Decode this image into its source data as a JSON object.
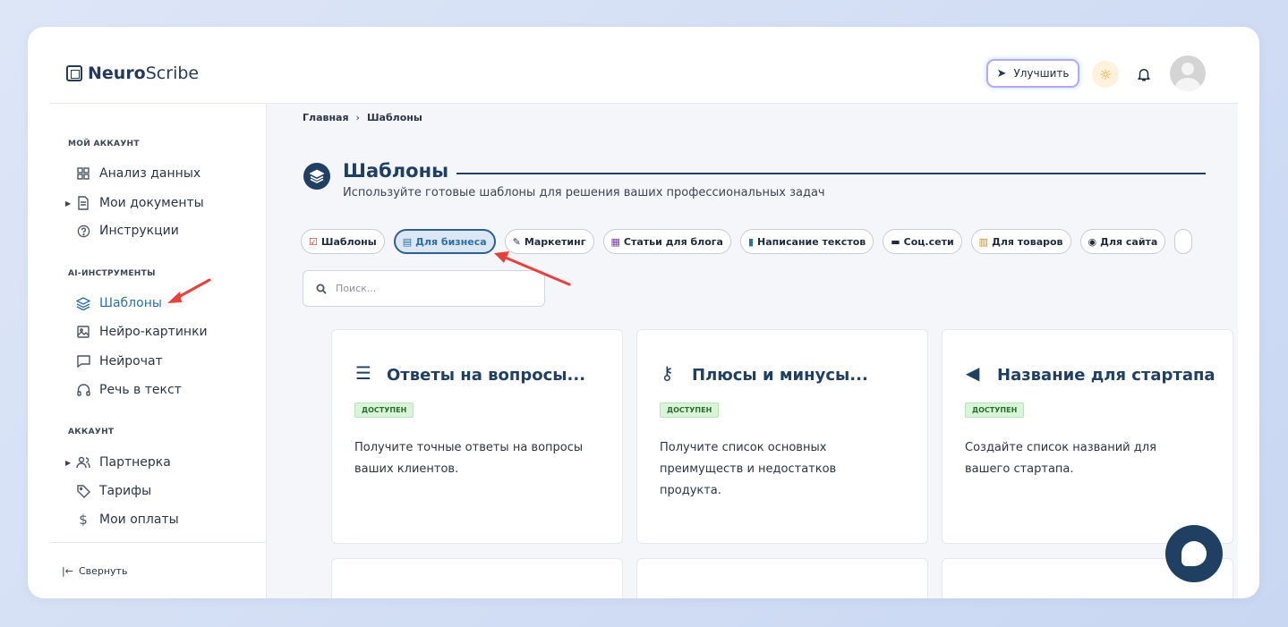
{
  "app": {
    "logo_bold": "Neuro",
    "logo_light": "Scribe"
  },
  "header": {
    "upgrade_label": "Улучшить"
  },
  "sidebar": {
    "sections": [
      {
        "label": "МОЙ АККАУНТ"
      },
      {
        "label": "AI-ИНСТРУМЕНТЫ"
      },
      {
        "label": "АККАУНТ"
      }
    ],
    "items": [
      {
        "label": "Анализ данных",
        "icon": "grid-icon"
      },
      {
        "label": "Мои документы",
        "icon": "document-icon"
      },
      {
        "label": "Инструкции",
        "icon": "help-icon"
      },
      {
        "label": "Шаблоны",
        "icon": "layers-icon",
        "active": true
      },
      {
        "label": "Нейро-картинки",
        "icon": "image-icon"
      },
      {
        "label": "Нейрочат",
        "icon": "chat-icon"
      },
      {
        "label": "Речь в текст",
        "icon": "headphones-icon"
      },
      {
        "label": "Партнерка",
        "icon": "users-icon"
      },
      {
        "label": "Тарифы",
        "icon": "tag-icon"
      },
      {
        "label": "Мои оплаты",
        "icon": "dollar-icon"
      }
    ],
    "collapse_label": "Свернуть"
  },
  "breadcrumb": {
    "home": "Главная",
    "sep": "›",
    "current": "Шаблоны"
  },
  "page": {
    "title": "Шаблоны",
    "subtitle": "Используйте готовые шаблоны для решения ваших профессиональных задач"
  },
  "filters": [
    {
      "label": "Шаблоны",
      "icon": "☑"
    },
    {
      "label": "Для бизнеса",
      "icon": "▤",
      "active": true
    },
    {
      "label": "Маркетинг",
      "icon": "✎"
    },
    {
      "label": "Статьи для блога",
      "icon": "▦"
    },
    {
      "label": "Написание текстов",
      "icon": "▮"
    },
    {
      "label": "Соц.сети",
      "icon": "▬"
    },
    {
      "label": "Для товаров",
      "icon": "▥"
    },
    {
      "label": "Для сайта",
      "icon": "◉"
    }
  ],
  "search": {
    "placeholder": "Поиск..."
  },
  "cards": [
    {
      "title": "Ответы на вопросы...",
      "badge": "ДОСТУПЕН",
      "desc": "Получите точные ответы на вопросы ваших клиентов.",
      "icon": "list-icon"
    },
    {
      "title": "Плюсы и минусы...",
      "badge": "ДОСТУПЕН",
      "desc": "Получите список основных преимуществ и недостатков продукта.",
      "icon": "key-icon"
    },
    {
      "title": "Название для стартапа",
      "badge": "ДОСТУПЕН",
      "desc": "Создайте список названий для вашего стартапа.",
      "icon": "megaphone-icon"
    }
  ],
  "colors": {
    "accent": "#1f3f63",
    "active": "#2e6fa3",
    "badge_bg": "#d8f5d7",
    "arrow": "#e8413c"
  }
}
